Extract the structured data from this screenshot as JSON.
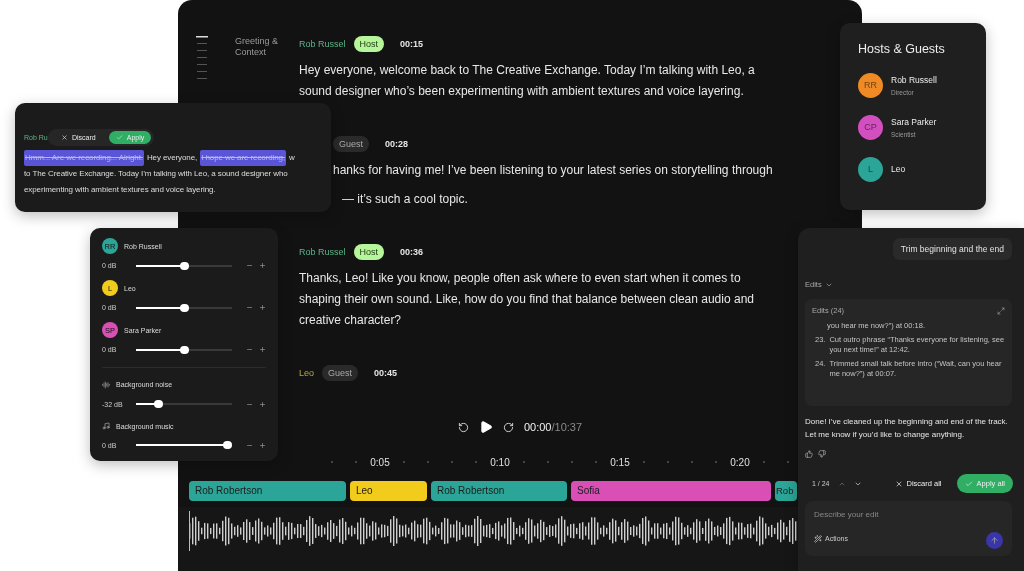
{
  "main_window": {
    "section_label": "Greeting & Context",
    "transcript": [
      {
        "kind": "host",
        "speaker": "Rob Russel",
        "role": "Host",
        "time": "00:15",
        "text": "Hey everyone, welcome back to The Creative Exchange. Today I’m talking with Leo, a sound designer who’s been experimenting with ambient textures and voice layering."
      },
      {
        "kind": "guest",
        "role": "Guest",
        "time": "00:28",
        "lines": [
          "hanks for having me! I’ve been listening to your latest series on storytelling through",
          "— it’s such a cool topic."
        ]
      },
      {
        "kind": "host",
        "speaker": "Rob Russel",
        "role": "Host",
        "time": "00:36",
        "text": "Thanks, Leo! Like you know, people often ask where to even start when it comes to shaping their own sound. Like, how do you find that balance between clean audio and creative character?"
      },
      {
        "kind": "guest",
        "speaker": "Leo",
        "role": "Guest",
        "time": "00:45"
      }
    ],
    "player": {
      "elapsed": "00:00",
      "duration": "/10:37"
    },
    "timeline": {
      "ticks": [
        "0:05",
        "0:10",
        "0:15",
        "0:20"
      ],
      "tracks": [
        {
          "label": "Rob Robertson",
          "color": "#2ba597"
        },
        {
          "label": "Leo",
          "color": "#f2cc1c"
        },
        {
          "label": "Rob Robertson",
          "color": "#2ba597"
        },
        {
          "label": "Sofia",
          "color": "#d94fb5"
        },
        {
          "label": "Rob",
          "color": "#2ba597"
        }
      ]
    }
  },
  "edit_card": {
    "speaker": "Rob Ru",
    "discard": "Discard",
    "apply": "Apply",
    "lines": [
      [
        {
          "kind": "removed",
          "text": "Hmm... Are we recording... Alright."
        },
        {
          "kind": "kept",
          "text": "Hey everyone,"
        },
        {
          "kind": "removed",
          "text": "I hope we are recording,"
        },
        {
          "kind": "kept",
          "text": "w"
        }
      ],
      [
        {
          "kind": "kept",
          "text": "to The Creative Exchange. Today I’m talking with Leo, a sound designer who"
        }
      ],
      [
        {
          "kind": "kept",
          "text": "experimenting with ambient textures and voice layering."
        }
      ]
    ]
  },
  "mixer": {
    "channels": [
      {
        "kind": "speaker",
        "name": "Rob Russell",
        "initials": "RR",
        "color": "#2ba597",
        "reading": "0 dB",
        "level": 0.5
      },
      {
        "kind": "speaker",
        "name": "Leo",
        "initials": "L",
        "color": "#f2cc1c",
        "reading": "0 dB",
        "level": 0.5
      },
      {
        "kind": "speaker",
        "name": "Sara Parker",
        "initials": "SP",
        "color": "#d94fb5",
        "reading": "0 dB",
        "level": 0.5
      },
      {
        "kind": "noise",
        "name": "Background noise",
        "reading": "-32 dB",
        "level": 0.23
      },
      {
        "kind": "music",
        "name": "Background music",
        "reading": "0 dB",
        "level": 0.95
      }
    ]
  },
  "hosts_panel": {
    "title": "Hosts & Guests",
    "people": [
      {
        "initials": "RR",
        "name": "Rob Russell",
        "role": "Director",
        "color": "#f08a24"
      },
      {
        "initials": "CP",
        "name": "Sara Parker",
        "role": "Scientist",
        "color": "#d34fbf"
      },
      {
        "initials": "L",
        "name": "Leo",
        "color": "#2ba597"
      }
    ]
  },
  "assistant": {
    "request": "Trim beginning and the end",
    "edits_toggle": "Edits",
    "edits_box": {
      "title": "Edits (24)",
      "items": [
        {
          "text": "you hear me now?”) at 00:18."
        },
        {
          "number": "23.",
          "text": "Cut outro phrase “Thanks everyone for listening, see you next time!” at 12:42."
        },
        {
          "number": "24.",
          "text": "Trimmed small talk before intro (“Wait, can you hear me now?”) at 00:07."
        }
      ]
    },
    "reply": "Done! I’ve cleaned up the beginning and end of the track.  Let me know if you’d like to change anything.",
    "counter": "1 / 24",
    "discard_all": "Discard all",
    "apply_all": "Apply all",
    "input": {
      "placeholder": "Describe your edit"
    },
    "actions": "Actions"
  }
}
